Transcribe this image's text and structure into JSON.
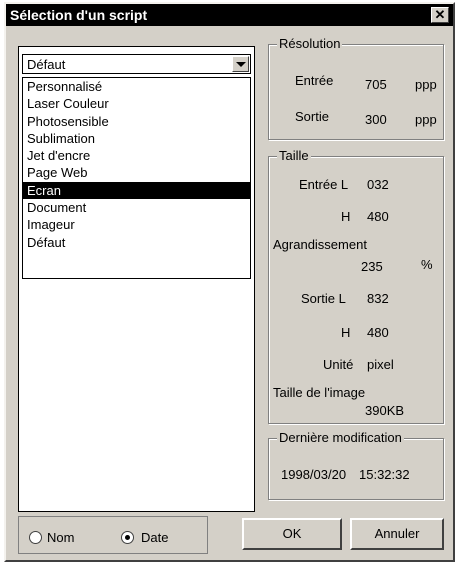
{
  "window": {
    "title": "Sélection d'un script",
    "close_symbol": "✕"
  },
  "script_select": {
    "value": "Défaut",
    "options": [
      "Personnalisé",
      "Laser Couleur",
      "Photosensible",
      "Sublimation",
      "Jet d'encre",
      "Page Web",
      "Ecran",
      "Document",
      "Imageur",
      "Défaut"
    ],
    "highlighted": "Ecran"
  },
  "resolution": {
    "title": "Résolution",
    "input_label": "Entrée",
    "input_value": "705",
    "input_unit": "ppp",
    "output_label": "Sortie",
    "output_value": "300",
    "output_unit": "ppp"
  },
  "size": {
    "title": "Taille",
    "input_w_label": "Entrée L",
    "input_w_value": "032",
    "input_h_label": "H",
    "input_h_value": "480",
    "scale_label": "Agrandissement",
    "scale_value": "235",
    "scale_unit": "%",
    "output_w_label": "Sortie L",
    "output_w_value": "832",
    "output_h_label": "H",
    "output_h_value": "480",
    "unit_label": "Unité",
    "unit_value": "pixel",
    "image_size_label": "Taille de l'image",
    "image_size_value": "390KB"
  },
  "last_modified": {
    "title": "Dernière modification",
    "date": "1998/03/20",
    "time": "15:32:32"
  },
  "sort": {
    "name_label": "Nom",
    "date_label": "Date",
    "selected": "Date"
  },
  "buttons": {
    "ok": "OK",
    "cancel": "Annuler"
  }
}
